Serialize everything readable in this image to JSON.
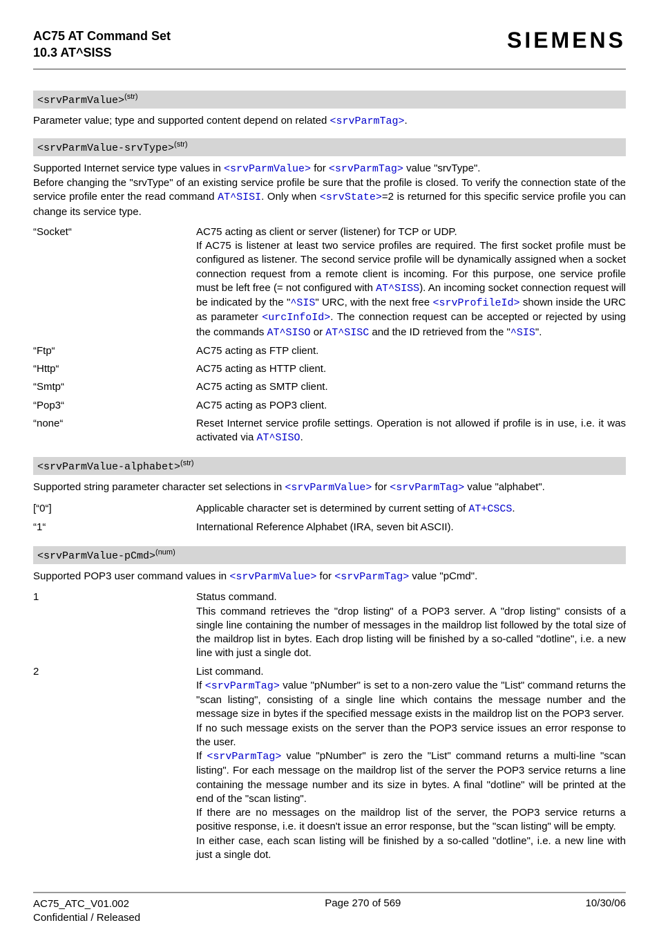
{
  "header": {
    "title_line1": "AC75 AT Command Set",
    "title_line2": "10.3 AT^SISS",
    "brand": "SIEMENS"
  },
  "sections": [
    {
      "hdr_code": "<srvParmValue>",
      "hdr_sup": "(str)",
      "intro_runs": [
        {
          "t": "Parameter value; type and supported content depend on related "
        },
        {
          "t": "<srvParmTag>",
          "cls": "blue mono"
        },
        {
          "t": "."
        }
      ],
      "rows": []
    },
    {
      "hdr_code": "<srvParmValue-srvType>",
      "hdr_sup": "(str)",
      "intro_runs": [
        {
          "t": "Supported Internet service type values in "
        },
        {
          "t": "<srvParmValue>",
          "cls": "blue mono"
        },
        {
          "t": " for "
        },
        {
          "t": "<srvParmTag>",
          "cls": "blue mono"
        },
        {
          "t": " value \"srvType\"."
        },
        {
          "t": "\nBefore changing the \"srvType\" of an existing service profile be sure that the profile is closed. To verify the connection state of the service profile enter the read command "
        },
        {
          "t": "AT^SISI",
          "cls": "blue mono"
        },
        {
          "t": ". Only when "
        },
        {
          "t": "<srvState>",
          "cls": "blue mono"
        },
        {
          "t": "=2 is returned for this specific service profile you can change its service type."
        }
      ],
      "rows": [
        {
          "k": "“Socket“",
          "v_runs": [
            {
              "t": "AC75 acting as client or server (listener) for TCP or UDP."
            },
            {
              "t": "\nIf AC75 is listener at least two service profiles are required. The first socket profile must be configured as listener. The second service profile will be dynamically assigned when a socket connection request from a remote client is incoming. For this purpose, one service profile must be left free (= not configured with "
            },
            {
              "t": "AT^SISS",
              "cls": "blue mono"
            },
            {
              "t": "). An incoming socket connection request will be indicated by the \""
            },
            {
              "t": "^SIS",
              "cls": "blue mono"
            },
            {
              "t": "\" URC, with the next free "
            },
            {
              "t": "<srvProfileId>",
              "cls": "blue mono"
            },
            {
              "t": " shown inside the URC as parameter "
            },
            {
              "t": "<urcInfoId>",
              "cls": "blue mono"
            },
            {
              "t": ". The connection request can be accepted or rejected by using the commands "
            },
            {
              "t": "AT^SISO",
              "cls": "blue mono"
            },
            {
              "t": " or "
            },
            {
              "t": "AT^SISC",
              "cls": "blue mono"
            },
            {
              "t": " and the ID retrieved from the \""
            },
            {
              "t": "^SIS",
              "cls": "blue mono"
            },
            {
              "t": "\"."
            }
          ]
        },
        {
          "k": "“Ftp“",
          "v_runs": [
            {
              "t": "AC75 acting as FTP client."
            }
          ]
        },
        {
          "k": "“Http“",
          "v_runs": [
            {
              "t": "AC75 acting as HTTP client."
            }
          ]
        },
        {
          "k": "“Smtp“",
          "v_runs": [
            {
              "t": "AC75 acting as SMTP client."
            }
          ]
        },
        {
          "k": "“Pop3“",
          "v_runs": [
            {
              "t": "AC75 acting as POP3 client."
            }
          ]
        },
        {
          "k": "“none“",
          "v_runs": [
            {
              "t": "Reset Internet service profile settings. Operation is not allowed if profile is in use, i.e. it was activated via "
            },
            {
              "t": "AT^SISO",
              "cls": "blue mono"
            },
            {
              "t": "."
            }
          ]
        }
      ]
    },
    {
      "hdr_code": "<srvParmValue-alphabet>",
      "hdr_sup": "(str)",
      "intro_runs": [
        {
          "t": "Supported string parameter character set selections in "
        },
        {
          "t": "<srvParmValue>",
          "cls": "blue mono"
        },
        {
          "t": " for "
        },
        {
          "t": "<srvParmTag>",
          "cls": "blue mono"
        },
        {
          "t": " value \"alphabet\"."
        }
      ],
      "rows": [
        {
          "k": "[“0“]",
          "v_runs": [
            {
              "t": "Applicable character set is determined by current setting of "
            },
            {
              "t": "AT+CSCS",
              "cls": "blue mono"
            },
            {
              "t": "."
            }
          ]
        },
        {
          "k": "“1“",
          "v_runs": [
            {
              "t": "International Reference Alphabet (IRA, seven bit ASCII)."
            }
          ]
        }
      ]
    },
    {
      "hdr_code": "<srvParmValue-pCmd>",
      "hdr_sup": "(num)",
      "intro_runs": [
        {
          "t": "Supported POP3 user command values in "
        },
        {
          "t": "<srvParmValue>",
          "cls": "blue mono"
        },
        {
          "t": " for "
        },
        {
          "t": "<srvParmTag>",
          "cls": "blue mono"
        },
        {
          "t": " value \"pCmd\"."
        }
      ],
      "rows": [
        {
          "k": "1",
          "v_runs": [
            {
              "t": "Status command."
            },
            {
              "t": "\nThis command retrieves the \"drop listing\" of a POP3 server. A \"drop listing\" consists of a single line containing the number of messages in the maildrop list followed by the total size of the maildrop list in bytes. Each drop listing will be finished by a so-called \"dotline\", i.e. a new line with just a single dot."
            }
          ]
        },
        {
          "k": "2",
          "v_runs": [
            {
              "t": "List command."
            },
            {
              "t": "\nIf "
            },
            {
              "t": "<srvParmTag>",
              "cls": "blue mono"
            },
            {
              "t": " value \"pNumber\" is set to a non-zero value the \"List\" command returns the \"scan listing\", consisting of a single line which contains the message number and the message size in bytes if the specified message exists in the maildrop list on the POP3 server."
            },
            {
              "t": "\nIf no such message exists on the server than the POP3 service issues an error response to the user."
            },
            {
              "t": "\nIf "
            },
            {
              "t": "<srvParmTag>",
              "cls": "blue mono"
            },
            {
              "t": " value \"pNumber\" is zero the \"List\" command returns a multi-line \"scan listing\". For each message on the maildrop list of the server the POP3 service returns a line containing the message number and its size in bytes. A final \"dotline\" will be printed at the end of the \"scan listing\"."
            },
            {
              "t": "\nIf there are no messages on the maildrop list of the server, the POP3 service returns a positive response, i.e. it doesn't issue an error response, but the \"scan listing\" will be empty."
            },
            {
              "t": "\nIn either case, each scan listing will be finished by a so-called \"dotline\", i.e. a new line with just a single dot."
            }
          ]
        }
      ]
    }
  ],
  "footer": {
    "left_line1": "AC75_ATC_V01.002",
    "left_line2": "Confidential / Released",
    "center": "Page 270 of 569",
    "right": "10/30/06"
  }
}
